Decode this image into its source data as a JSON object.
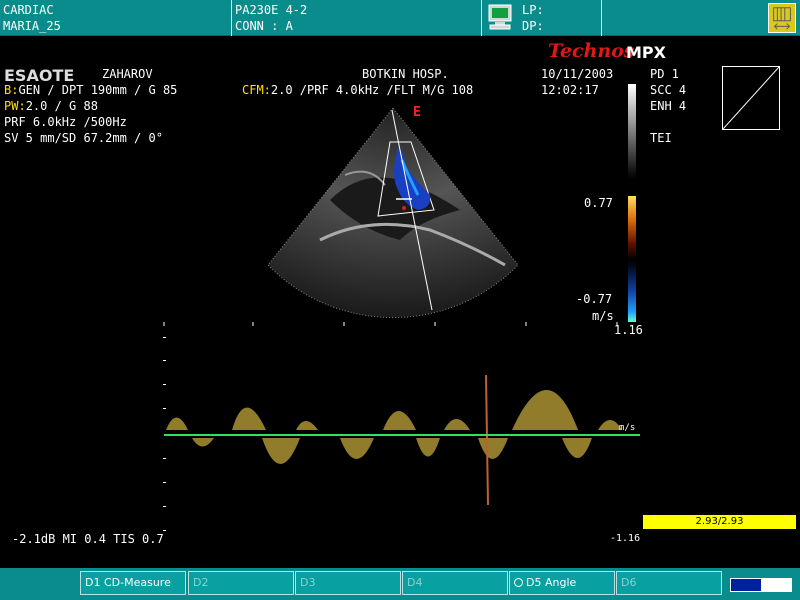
{
  "header": {
    "patient_type": "CARDIAC",
    "patient_name": "MARIA_25",
    "probe": "PA230E 4-2",
    "connector": "CONN : A",
    "lp_label": "LP:",
    "dp_label": "DP:"
  },
  "brand": {
    "esaote": "ESAOTE",
    "technos": "Technos",
    "mpx": "MPX"
  },
  "info": {
    "operator": "ZAHAROV",
    "hospital": "BOTKIN HOSP.",
    "date": "10/11/2003",
    "time": "12:02:17",
    "b_line_prefix": "B:",
    "b_line": "GEN / DPT 190mm / G 85",
    "cfm_prefix": "CFM:",
    "cfm_line": "2.0 /PRF 4.0kHz /FLT M/G 108",
    "pw_prefix": "PW:",
    "pw_line": "2.0 / G 88",
    "prf_line": "PRF 6.0kHz /500Hz",
    "sv_line": "SV 5 mm/SD 67.2mm /   0°"
  },
  "settings": {
    "pd": "PD  1",
    "scc": "SCC 4",
    "enh": "ENH 4",
    "tei": "TEI"
  },
  "color_scale": {
    "top": "0.77",
    "bottom": "-0.77",
    "unit": "m/s",
    "doppler_top": "1.16",
    "doppler_bottom": "-1.16",
    "doppler_unit": "m/s"
  },
  "marker": "E",
  "footer": {
    "output_text": "-2.1dB MI 0.4 TIS 0.7",
    "measure_value": "2.93/2.93"
  },
  "function_keys": [
    {
      "label": "D1 CD-Measure"
    },
    {
      "label": "D2"
    },
    {
      "label": "D3"
    },
    {
      "label": "D4"
    },
    {
      "label": "D5 Angle"
    },
    {
      "label": "D6"
    }
  ],
  "status_level": 0.5,
  "colors": {
    "header_bg": "#0a8c8c",
    "baseline": "#30e060",
    "highlight": "#ffff00",
    "brand_red": "#e01818"
  }
}
